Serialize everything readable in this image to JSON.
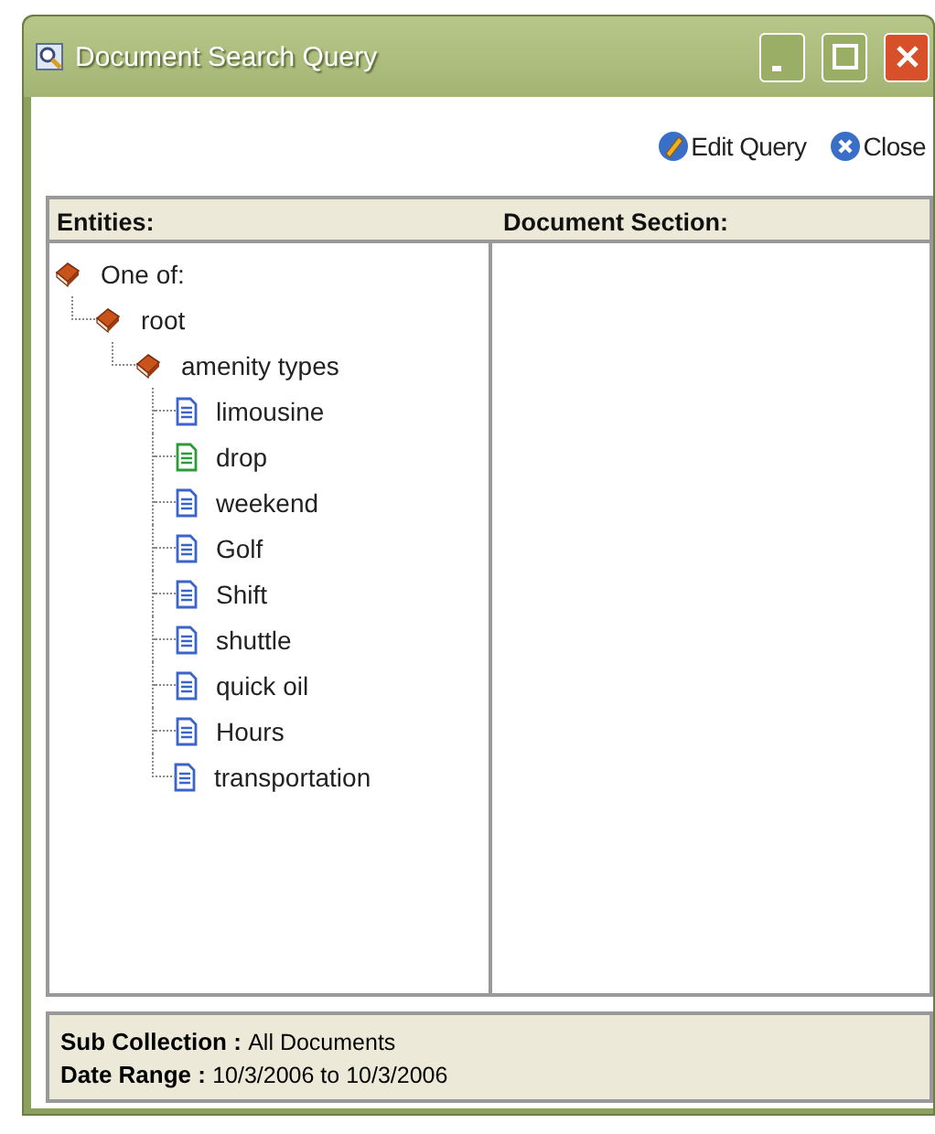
{
  "window": {
    "title": "Document Search Query"
  },
  "toolbar": [
    {
      "kind": "edit",
      "label": "Edit Query"
    },
    {
      "kind": "close",
      "label": "Close"
    }
  ],
  "columns": [
    "Entities:",
    "Document Section:"
  ],
  "tree": [
    {
      "label": "One of:",
      "kind": "book",
      "children": [
        {
          "label": "root",
          "kind": "book",
          "children": [
            {
              "label": "amenity types",
              "kind": "book",
              "children": [
                {
                  "label": "limousine",
                  "kind": "doc",
                  "color": "#3a64c8"
                },
                {
                  "label": "drop",
                  "kind": "doc",
                  "color": "#2f9a3a"
                },
                {
                  "label": "weekend",
                  "kind": "doc",
                  "color": "#3a64c8"
                },
                {
                  "label": "Golf",
                  "kind": "doc",
                  "color": "#3a64c8"
                },
                {
                  "label": "Shift",
                  "kind": "doc",
                  "color": "#3a64c8"
                },
                {
                  "label": "shuttle",
                  "kind": "doc",
                  "color": "#3a64c8"
                },
                {
                  "label": "quick oil",
                  "kind": "doc",
                  "color": "#3a64c8"
                },
                {
                  "label": "Hours",
                  "kind": "doc",
                  "color": "#3a64c8"
                },
                {
                  "label": "transportation",
                  "kind": "doc",
                  "color": "#3a64c8"
                }
              ]
            }
          ]
        }
      ]
    }
  ],
  "footer": [
    {
      "label": "Sub Collection :",
      "value": "All Documents"
    },
    {
      "label": "Date Range :",
      "value": "10/3/2006 to 10/3/2006"
    }
  ]
}
